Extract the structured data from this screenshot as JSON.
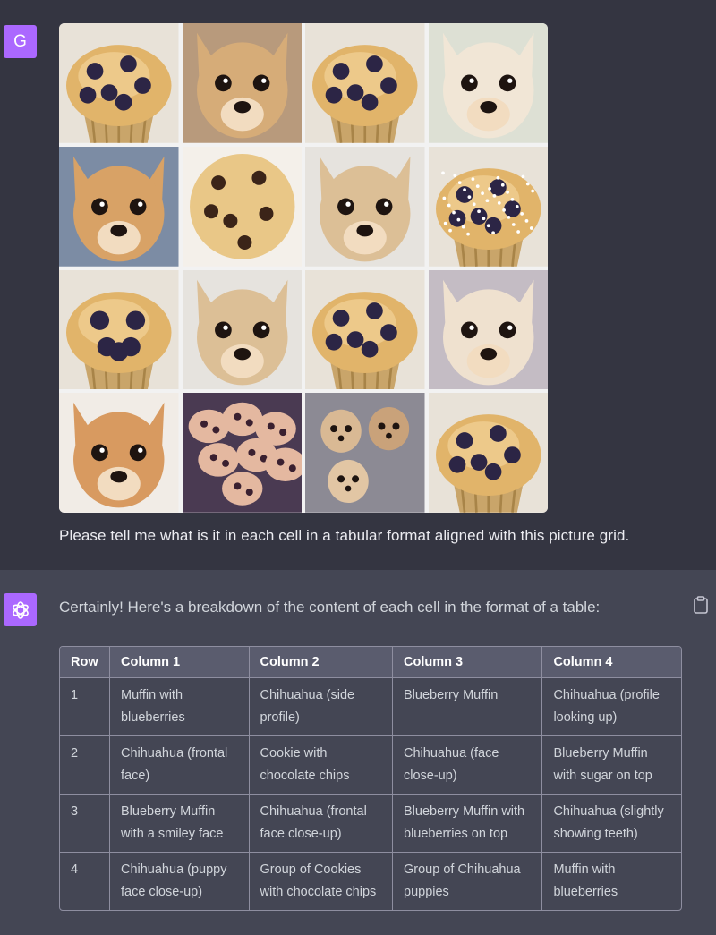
{
  "user": {
    "avatar_letter": "G",
    "message": "Please tell me what is it in each cell in a tabular format aligned with this picture grid.",
    "grid": [
      [
        "muffin",
        "chihuahua-side",
        "muffin",
        "chihuahua-up"
      ],
      [
        "chihuahua-front",
        "cookie",
        "chihuahua",
        "muffin-sugar"
      ],
      [
        "muffin-smiley",
        "chihuahua",
        "muffin",
        "chihuahua-teeth"
      ],
      [
        "chihuahua-puppy",
        "cookies",
        "puppies",
        "muffin"
      ]
    ]
  },
  "assistant": {
    "intro": "Certainly! Here's a breakdown of the content of each cell in the format of a table:",
    "table": {
      "headers": [
        "Row",
        "Column 1",
        "Column 2",
        "Column 3",
        "Column 4"
      ],
      "rows": [
        [
          "1",
          "Muffin with blueberries",
          "Chihuahua (side profile)",
          "Blueberry Muffin",
          "Chihuahua (profile looking up)"
        ],
        [
          "2",
          "Chihuahua (frontal face)",
          "Cookie with chocolate chips",
          "Chihuahua (face close-up)",
          "Blueberry Muffin with sugar on top"
        ],
        [
          "3",
          "Blueberry Muffin with a smiley face",
          "Chihuahua (frontal face close-up)",
          "Blueberry Muffin with blueberries on top",
          "Chihuahua (slightly showing teeth)"
        ],
        [
          "4",
          "Chihuahua (puppy face close-up)",
          "Group of Cookies with chocolate chips",
          "Group of Chihuahua puppies",
          "Muffin with blueberries"
        ]
      ]
    }
  },
  "colors": {
    "user_bg": "#343541",
    "assistant_bg": "#444654",
    "avatar": "#ab68ff"
  },
  "icons": [
    "openai-logo-icon",
    "clipboard-icon"
  ]
}
